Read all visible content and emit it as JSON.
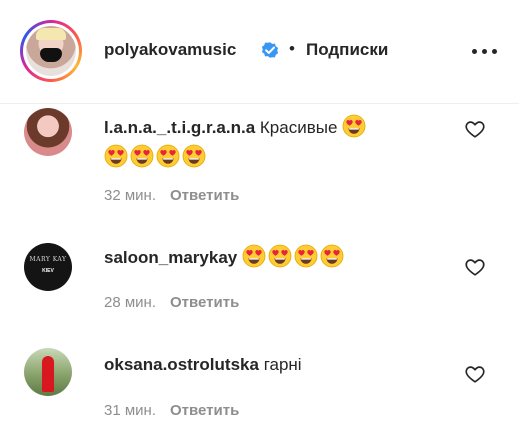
{
  "header": {
    "username": "polyakovamusic",
    "separator": "•",
    "follow_label": "Подписки"
  },
  "comments": [
    {
      "username": "l.a.n.a._.t.i.g.r.a.n.a",
      "text": "Красивые",
      "emoji": [
        "heart-eyes",
        "heart-eyes",
        "heart-eyes",
        "heart-eyes",
        "heart-eyes"
      ],
      "time": "32 мин.",
      "reply_label": "Ответить"
    },
    {
      "username": "saloon_marykay",
      "text": "",
      "emoji": [
        "heart-eyes",
        "heart-eyes",
        "heart-eyes",
        "heart-eyes"
      ],
      "time": "28 мин.",
      "reply_label": "Ответить",
      "avatar_text": [
        "MARY KAY",
        "KIEV"
      ]
    },
    {
      "username": "oksana.ostrolutska",
      "text": "гарні",
      "emoji": [],
      "time": "31 мин.",
      "reply_label": "Ответить"
    }
  ],
  "colors": {
    "verified_badge": "#3897f0",
    "muted_text": "#8e8e8e",
    "emoji_face": "#ffcc33",
    "emoji_heart": "#e8243c"
  },
  "icons": {
    "more": "more-horizontal-icon",
    "like": "heart-outline-icon",
    "verified": "verified-badge-icon",
    "emoji": "heart-eyes-emoji-icon"
  }
}
